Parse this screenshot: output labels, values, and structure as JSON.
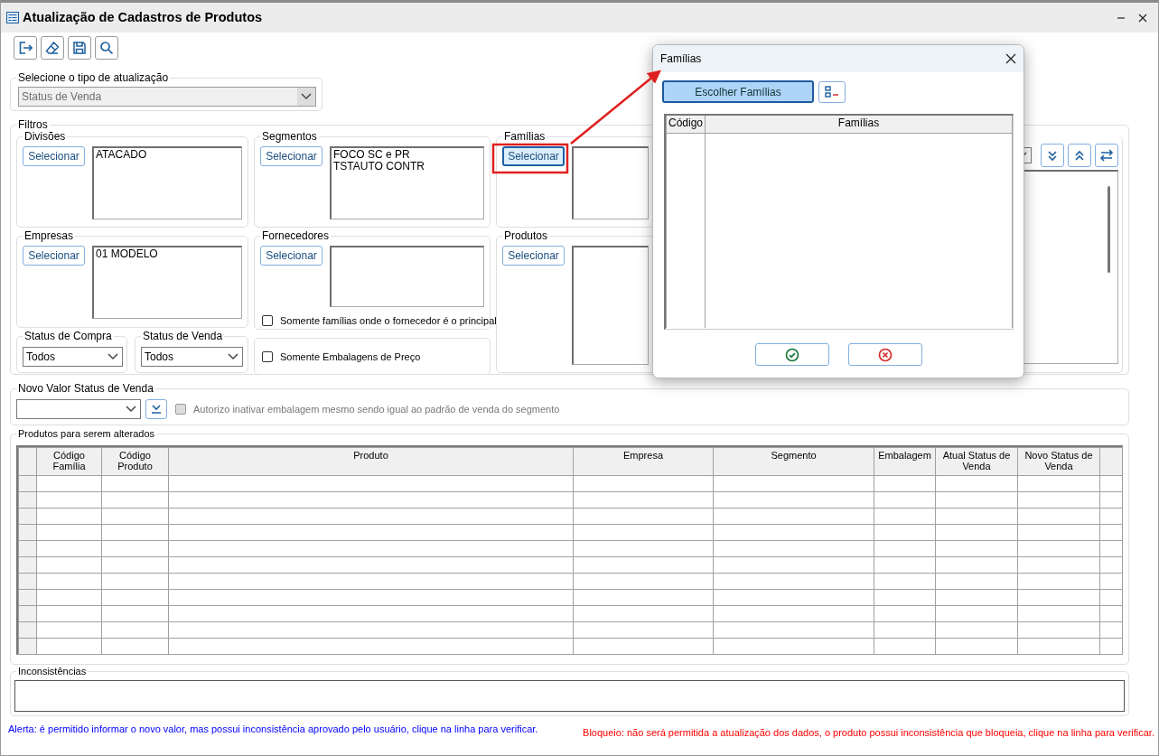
{
  "window": {
    "title": "Atualização de Cadastros de Produtos"
  },
  "toolbar": [
    {
      "kind": "exit"
    },
    {
      "kind": "clear"
    },
    {
      "kind": "save"
    },
    {
      "kind": "search"
    }
  ],
  "update_type": {
    "label": "Selecione o tipo de atualização",
    "value": "Status de Venda",
    "disabled": true
  },
  "filters": {
    "label": "Filtros",
    "selectors": [
      {
        "label": "Divisões",
        "button": "Selecionar",
        "focused": false,
        "items": [
          "ATACADO"
        ]
      },
      {
        "label": "Segmentos",
        "button": "Selecionar",
        "focused": false,
        "items": [
          "FOCO SC e PR",
          "TSTAUTO CONTR"
        ]
      },
      {
        "label": "Famílias",
        "button": "Selecionar",
        "focused": true
      },
      {
        "label": "Empresas",
        "button": "Selecionar",
        "focused": false,
        "items": [
          "01 MODELO"
        ]
      },
      {
        "label": "Fornecedores",
        "button": "Selecionar",
        "focused": false
      },
      {
        "label": "Produtos",
        "button": "Selecionar",
        "focused": false
      }
    ],
    "options": [
      {
        "label": "Somente famílias onde o fornecedor é o principal",
        "checked": false
      },
      {
        "label": "Somente Embalagens de Preço",
        "checked": false
      }
    ],
    "status": [
      {
        "label": "Status de Compra",
        "value": "Todos"
      },
      {
        "label": "Status de Venda",
        "value": "Todos"
      }
    ]
  },
  "new_value": {
    "label": "Novo Valor Status de Venda",
    "checkbox": {
      "label": "Autorizo inativar embalagem mesmo sendo igual ao padrão de venda do segmento",
      "checked": false,
      "disabled": true
    }
  },
  "products": {
    "label": "Produtos para serem alterados",
    "columns": [
      "Código Família",
      "Código Produto",
      "Produto",
      "Empresa",
      "Segmento",
      "Embalagem",
      "Atual Status de Venda",
      "Novo Status de Venda"
    ]
  },
  "inconsistencies": {
    "label": "Inconsistências"
  },
  "legend": [
    {
      "kind": "alert",
      "text": "Alerta: é permitido informar o novo valor, mas possui inconsistência aprovado pelo usuário, clique na linha para verificar."
    },
    {
      "kind": "block",
      "text": "Bloqueio: não será permitida a atualização dos dados, o produto possui inconsistência que bloqueia, clique na linha para verificar."
    }
  ],
  "dialog": {
    "title": "Famílias",
    "button": "Escolher Famílias",
    "columns": [
      "Código",
      "Famílias"
    ]
  }
}
